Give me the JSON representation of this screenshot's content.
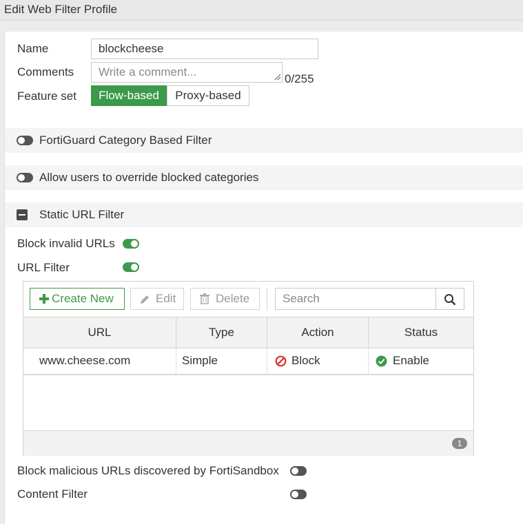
{
  "window": {
    "title": "Edit Web Filter Profile"
  },
  "form": {
    "name_label": "Name",
    "name_value": "blockcheese",
    "comments_label": "Comments",
    "comments_placeholder": "Write a comment...",
    "comments_counter": "0/255",
    "feature_set_label": "Feature set",
    "feature_set_options": [
      "Flow-based",
      "Proxy-based"
    ],
    "feature_set_selected": "Flow-based"
  },
  "sections": {
    "fortiguard": {
      "label": "FortiGuard Category Based Filter",
      "enabled": false
    },
    "override": {
      "label": "Allow users to override blocked categories",
      "enabled": false
    },
    "static_url": {
      "label": "Static URL Filter",
      "expanded": true
    }
  },
  "static_url_filter": {
    "block_invalid_label": "Block invalid URLs",
    "block_invalid_enabled": true,
    "url_filter_label": "URL Filter",
    "url_filter_enabled": true,
    "toolbar": {
      "create_label": "Create New",
      "edit_label": "Edit",
      "delete_label": "Delete",
      "search_placeholder": "Search"
    },
    "columns": [
      "URL",
      "Type",
      "Action",
      "Status"
    ],
    "rows": [
      {
        "url": "www.cheese.com",
        "type": "Simple",
        "action": "Block",
        "status": "Enable"
      }
    ],
    "count": "1"
  },
  "bottom": {
    "sandbox_label": "Block malicious URLs discovered by FortiSandbox",
    "sandbox_enabled": false,
    "content_filter_label": "Content Filter",
    "content_filter_enabled": false
  },
  "colors": {
    "accent_green": "#3c9a4a",
    "block_red": "#d9302c",
    "enable_green": "#3c9a4a"
  }
}
